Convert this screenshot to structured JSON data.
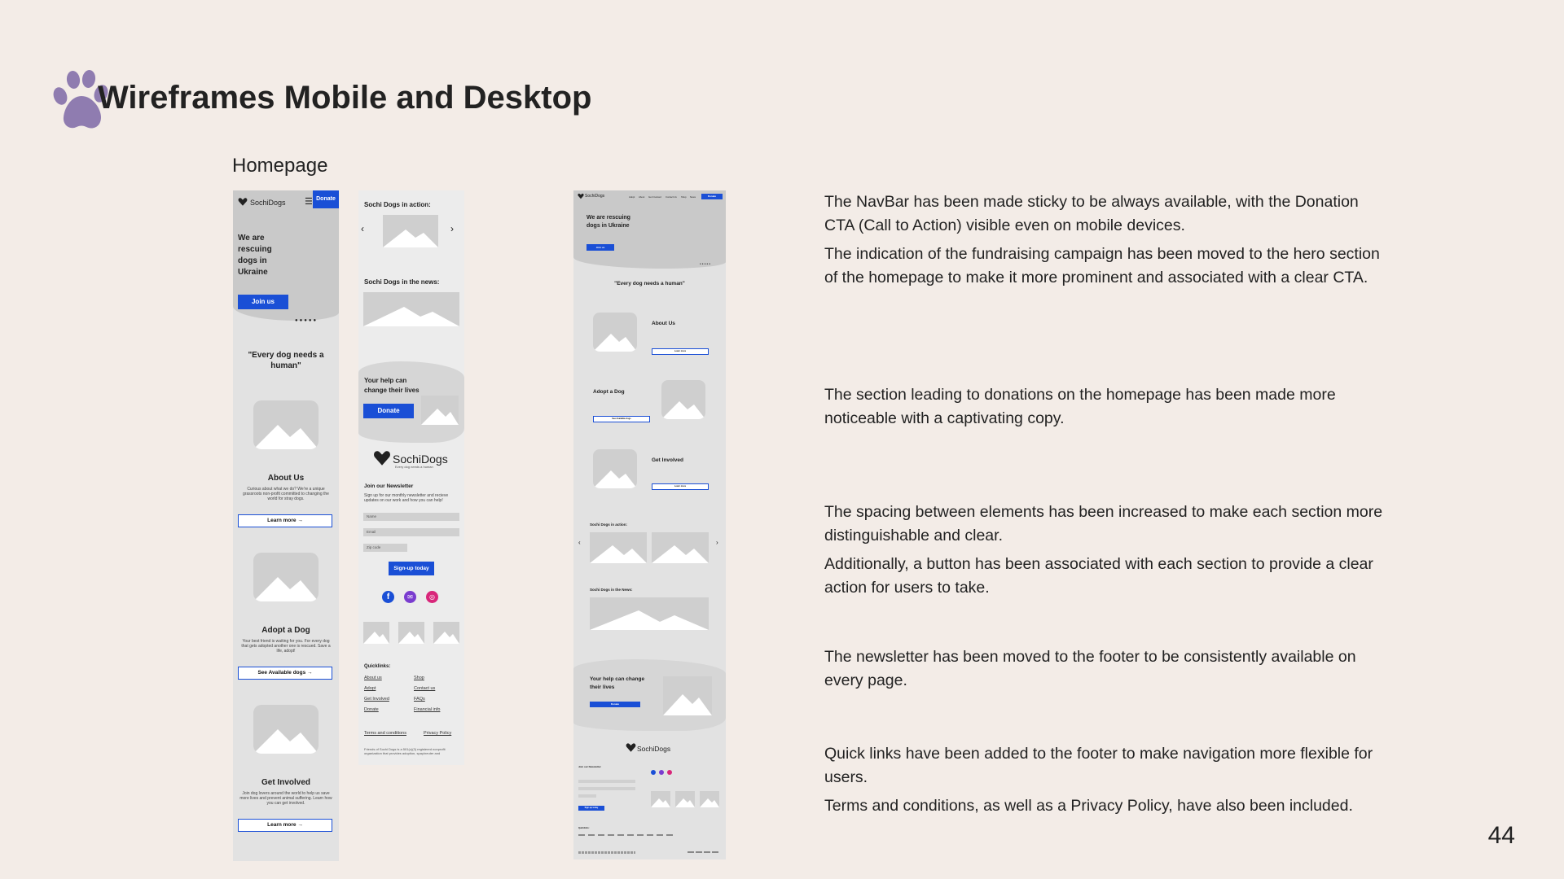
{
  "slide": {
    "title": "Wireframes Mobile and Desktop",
    "section": "Homepage",
    "page_number": "44"
  },
  "notes": [
    {
      "paragraphs": [
        "The NavBar has been made sticky to be always available, with the Donation CTA (Call to Action) visible even on mobile devices.",
        "The indication of the fundraising campaign has been moved to the hero section of the homepage to make it more prominent and associated with a clear CTA."
      ]
    },
    {
      "paragraphs": [
        "The section leading to donations on the homepage has been made more noticeable with a captivating copy."
      ]
    },
    {
      "paragraphs": [
        "The spacing between elements has been increased to make each section more distinguishable and clear.",
        "Additionally, a button has been associated with each section to provide a clear action for users to take."
      ]
    },
    {
      "paragraphs": [
        "The newsletter has been moved to the footer to be consistently available on every page."
      ]
    },
    {
      "paragraphs": [
        "Quick links have been added to the footer to make navigation more flexible for users.",
        "Terms and conditions, as well as a Privacy Policy, have also been included."
      ]
    }
  ],
  "mobile1": {
    "logo": "SochiDogs",
    "donate": "Donate",
    "hero": "We are rescuing dogs in Ukraine",
    "join": "Join us",
    "quote": "\"Every dog needs a human\"",
    "about_title": "About Us",
    "about_text": "Curious about what we do? We're a unique grassroots non-profit committed to changing the world for stray dogs.",
    "about_btn": "Learn more",
    "adopt_title": "Adopt a Dog",
    "adopt_text": "Your best friend is waiting for you. For every dog that gets adopted another one is rescued. Save a life, adopt!",
    "adopt_btn": "See Available dogs",
    "involved_title": "Get Involved",
    "involved_text": "Join dog lovers around the world to help us save more lives and prevent animal suffering. Learn how you can get involved.",
    "involved_btn": "Learn more"
  },
  "mobile2": {
    "action": "Sochi Dogs in action:",
    "news": "Sochi Dogs in the news:",
    "help": "Your help can change their lives",
    "donate": "Donate",
    "logo": "SochiDogs",
    "tagline": "Every dog needs a human",
    "newsletter": "Join our Newsletter",
    "newsletter_text": "Sign up for our monthly newsletter and recieve updates on our work and how you can help!",
    "name": "Name",
    "email": "Email",
    "zip": "Zip code",
    "signup": "Sign-up today",
    "quicklinks": "Quicklinks:",
    "links_left": [
      "About us",
      "Adopt",
      "Get Involved",
      "Donate"
    ],
    "links_right": [
      "Shop",
      "Contact us",
      "FAQs",
      "Financial info"
    ],
    "terms": "Terms and conditions",
    "privacy": "Privacy Policy",
    "legal": "Friends of Sochi Dogs is a 501(c)(3) registered nonprofit organization that provides adoption, spay/neuter and"
  },
  "desktop": {
    "logo": "SochiDogs",
    "nav": [
      "Adopt",
      "About",
      "Get Involved",
      "Contact Us",
      "Shop",
      "News"
    ],
    "donate": "Donate",
    "hero": "We are rescuing dogs in Ukraine",
    "join": "Join us",
    "quote": "\"Every dog needs a human\"",
    "about_title": "About Us",
    "about_btn": "Learn more",
    "adopt_title": "Adopt a Dog",
    "adopt_btn": "See Available dogs",
    "involved_title": "Get Involved",
    "involved_btn": "Learn more",
    "action": "Sochi Dogs in action:",
    "news": "Sochi Dogs in the News:",
    "help": "Your help can change their lives",
    "help_btn": "Donate",
    "footer_logo": "SochiDogs",
    "newsletter": "Join our Newsletter",
    "signup": "Sign-up today",
    "quicklinks": "Quicklinks:"
  },
  "colors": {
    "background": "#f3ece7",
    "accent": "#1a4fd6",
    "paw": "#8f7cb0",
    "wireframe": "#e2e2e2"
  }
}
